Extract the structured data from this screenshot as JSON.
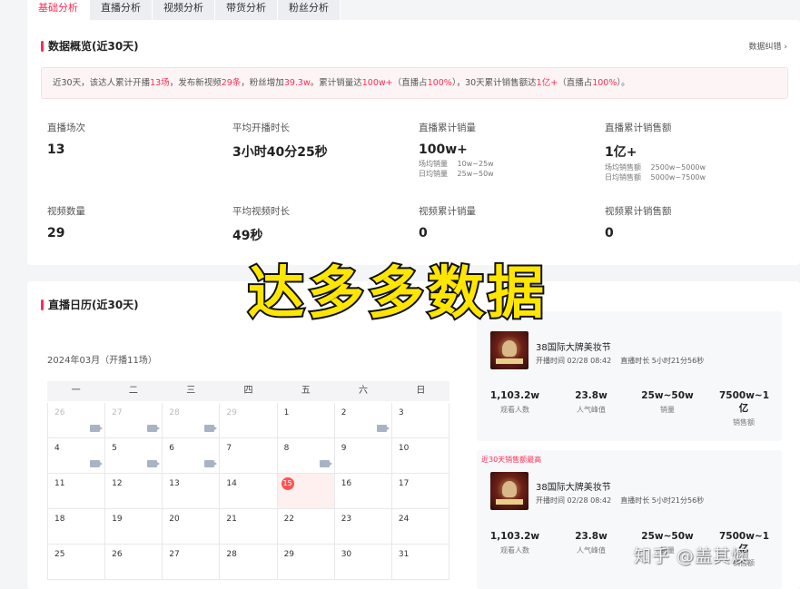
{
  "tabs": [
    {
      "label": "基础分析"
    },
    {
      "label": "直播分析"
    },
    {
      "label": "视频分析"
    },
    {
      "label": "带货分析"
    },
    {
      "label": "粉丝分析"
    }
  ],
  "overview": {
    "title": "数据概览(近30天)",
    "error_link": "数据纠错 ›",
    "summary": {
      "p1": "近30天，该达人累计开播",
      "live_count": "13场",
      "p2": "，发布新视频",
      "video_count": "29条",
      "p3": "，粉丝增加",
      "fans_gain": "39.3w",
      "p4": "。累计销量达",
      "sales": "100w+",
      "p5": "（直播占",
      "sales_live_pct": "100%",
      "p6": "），30天累计销售额达",
      "gmv": "1亿+",
      "p7": "（直播占",
      "gmv_live_pct": "100%",
      "p8": "）。"
    },
    "metrics": {
      "live_sessions": {
        "label": "直播场次",
        "value": "13"
      },
      "avg_live_duration": {
        "label": "平均开播时长",
        "value": "3小时40分25秒"
      },
      "live_sales": {
        "label": "直播累计销量",
        "value": "100w+",
        "sub1_label": "场均销量",
        "sub1_value": "10w~25w",
        "sub2_label": "日均销量",
        "sub2_value": "25w~50w"
      },
      "live_gmv": {
        "label": "直播累计销售额",
        "value": "1亿+",
        "sub1_label": "场均销售额",
        "sub1_value": "2500w~5000w",
        "sub2_label": "日均销售额",
        "sub2_value": "5000w~7500w"
      },
      "video_count": {
        "label": "视频数量",
        "value": "29"
      },
      "avg_video_duration": {
        "label": "平均视频时长",
        "value": "49秒"
      },
      "video_sales": {
        "label": "视频累计销量",
        "value": "0"
      },
      "video_gmv": {
        "label": "视频累计销售额",
        "value": "0"
      }
    }
  },
  "calendar": {
    "title": "直播日历(近30天)",
    "month_label": "2024年03月（开播11场）",
    "weekdays": [
      "一",
      "二",
      "三",
      "四",
      "五",
      "六",
      "日"
    ],
    "weeks": [
      [
        {
          "d": "26",
          "muted": true,
          "live": true
        },
        {
          "d": "27",
          "muted": true,
          "live": true
        },
        {
          "d": "28",
          "muted": true,
          "live": true
        },
        {
          "d": "29",
          "muted": true,
          "live": false
        },
        {
          "d": "1",
          "muted": false,
          "live": false
        },
        {
          "d": "2",
          "muted": false,
          "live": true
        },
        {
          "d": "3",
          "muted": false,
          "live": false
        }
      ],
      [
        {
          "d": "4",
          "muted": false,
          "live": true
        },
        {
          "d": "5",
          "muted": false,
          "live": true
        },
        {
          "d": "6",
          "muted": false,
          "live": true
        },
        {
          "d": "7",
          "muted": false,
          "live": false
        },
        {
          "d": "8",
          "muted": false,
          "live": true
        },
        {
          "d": "9",
          "muted": false,
          "live": false
        },
        {
          "d": "10",
          "muted": false,
          "live": false
        }
      ],
      [
        {
          "d": "11",
          "muted": false,
          "live": false
        },
        {
          "d": "12",
          "muted": false,
          "live": false
        },
        {
          "d": "13",
          "muted": false,
          "live": false
        },
        {
          "d": "14",
          "muted": false,
          "live": false
        },
        {
          "d": "15",
          "muted": false,
          "live": false,
          "today": true
        },
        {
          "d": "16",
          "muted": false,
          "live": false
        },
        {
          "d": "17",
          "muted": false,
          "live": false
        }
      ],
      [
        {
          "d": "18",
          "muted": false,
          "live": false
        },
        {
          "d": "19",
          "muted": false,
          "live": false
        },
        {
          "d": "20",
          "muted": false,
          "live": false
        },
        {
          "d": "21",
          "muted": false,
          "live": false
        },
        {
          "d": "22",
          "muted": false,
          "live": false
        },
        {
          "d": "23",
          "muted": false,
          "live": false
        },
        {
          "d": "24",
          "muted": false,
          "live": false
        }
      ],
      [
        {
          "d": "25",
          "muted": false,
          "live": false
        },
        {
          "d": "26",
          "muted": false,
          "live": false
        },
        {
          "d": "27",
          "muted": false,
          "live": false
        },
        {
          "d": "28",
          "muted": false,
          "live": false
        },
        {
          "d": "29",
          "muted": false,
          "live": false
        },
        {
          "d": "30",
          "muted": false,
          "live": false
        },
        {
          "d": "31",
          "muted": false,
          "live": false
        }
      ]
    ]
  },
  "live_cards": [
    {
      "tag": "",
      "title": "38国际大牌美妆节",
      "start_time": "开播时间 02/28 08:42",
      "duration": "直播时长 5小时21分56秒",
      "stats": [
        {
          "value": "1,103.2w",
          "label": "观看人数"
        },
        {
          "value": "23.8w",
          "label": "人气峰值"
        },
        {
          "value": "25w~50w",
          "label": "销量"
        },
        {
          "value": "7500w~1亿",
          "label": "销售额"
        }
      ]
    },
    {
      "tag": "近30天销售额最高",
      "title": "38国际大牌美妆节",
      "start_time": "开播时间 02/28 08:42",
      "duration": "直播时长 5小时21分56秒",
      "stats": [
        {
          "value": "1,103.2w",
          "label": "观看人数"
        },
        {
          "value": "23.8w",
          "label": "人气峰值"
        },
        {
          "value": "25w~50w",
          "label": "销量"
        },
        {
          "value": "7500w~1亿",
          "label": "销售额"
        }
      ]
    }
  ],
  "overlay_caption": "达多多数据",
  "watermark": "知乎 @盖其燠",
  "colors": {
    "accent": "#ff2c55",
    "caption_fill": "#ffe600",
    "caption_stroke": "#111111"
  }
}
